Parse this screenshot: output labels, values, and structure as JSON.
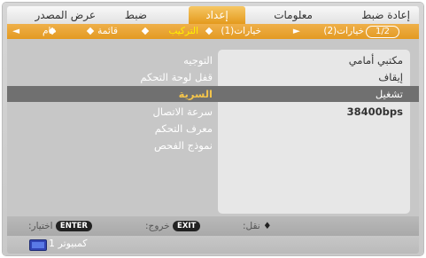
{
  "top_menu": {
    "items": [
      {
        "label": "إعادة ضبط"
      },
      {
        "label": "معلومات"
      },
      {
        "label": "إعداد"
      },
      {
        "label": "ضبط"
      },
      {
        "label": "عرض المصدر"
      }
    ],
    "active_index": 2
  },
  "tabs": {
    "page_indicator": "1/2",
    "items": [
      {
        "label": "خيارات(2)"
      },
      {
        "label": "خيارات(1)"
      },
      {
        "label": "التركيب"
      },
      {
        "label": "قائمة"
      },
      {
        "label": "عام"
      }
    ],
    "active_index": 2
  },
  "settings": [
    {
      "label": "التوجيه",
      "value": "مكتبي أمامي"
    },
    {
      "label": "قفل لوحة التحكم",
      "value": "إيقاف"
    },
    {
      "label": "السرية",
      "value": "تشغيل"
    },
    {
      "label": "سرعة الاتصال",
      "value": "38400bps"
    },
    {
      "label": "معرف التحكم",
      "value": ""
    },
    {
      "label": "نموذج الفحص",
      "value": ""
    }
  ],
  "selected_index": 2,
  "hints": {
    "move_label": "نقل:",
    "move_key": "♦",
    "exit_label": "خروج:",
    "exit_key": "EXIT",
    "select_label": "اختيار:",
    "select_key": "ENTER"
  },
  "status": {
    "source_label": "كمبيوتر 1",
    "icon": "computer-source-icon"
  }
}
